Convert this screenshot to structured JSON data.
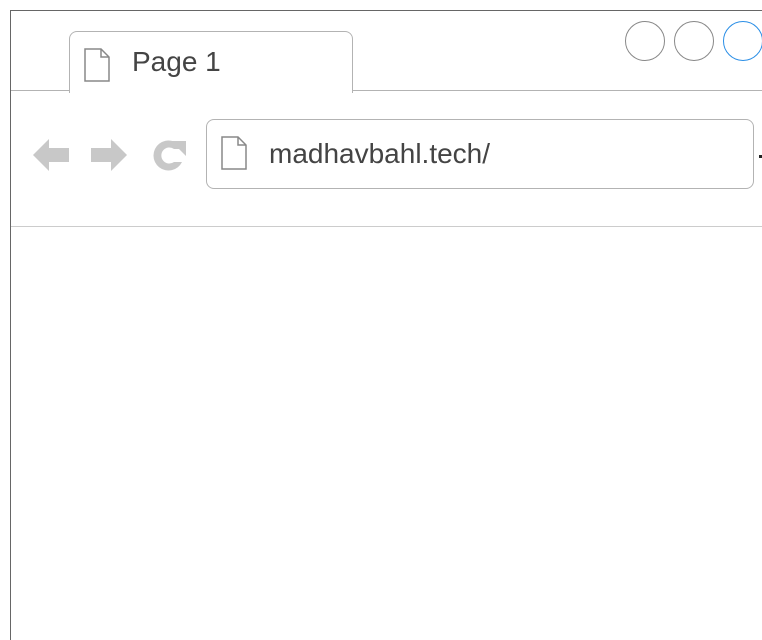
{
  "tabs": [
    {
      "label": "Page 1",
      "icon": "page-icon"
    }
  ],
  "window_controls": [
    "minimize-button",
    "maximize-button",
    "close-button"
  ],
  "navigation": {
    "back_icon": "back-arrow-icon",
    "forward_icon": "forward-arrow-icon",
    "reload_icon": "reload-icon"
  },
  "address_bar": {
    "url": "madhavbahl.tech/",
    "icon": "page-icon"
  },
  "colors": {
    "icon_gray": "#c8c8c8",
    "border": "#b3b3b3",
    "active_control": "#2a8ee6",
    "text": "#444444"
  }
}
